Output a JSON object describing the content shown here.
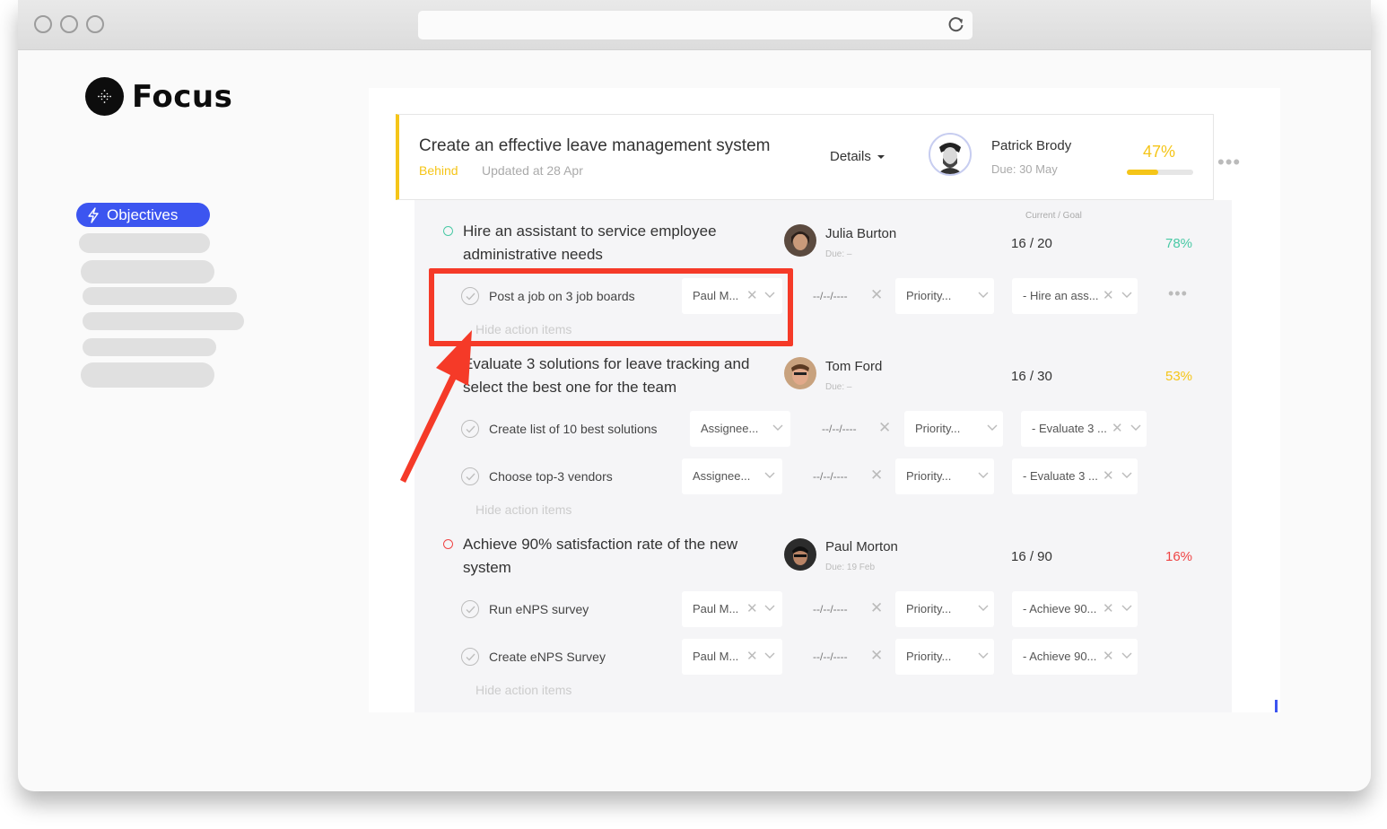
{
  "app": {
    "name": "Focus"
  },
  "sidebar": {
    "active_item": "Objectives"
  },
  "objective": {
    "title": "Create an effective leave management system",
    "status": "Behind",
    "updated": "Updated at 28 Apr",
    "details_label": "Details",
    "owner": "Patrick Brody",
    "due": "Due: 30 May",
    "percent": "47%",
    "progress": 0.47,
    "colors": {
      "behind": "#f5c518",
      "accent": "#3c55f0",
      "highlight": "#f53a28"
    }
  },
  "current_goal_label": "Current / Goal",
  "key_results": [
    {
      "title": "Hire an assistant to service employee administrative needs",
      "owner": "Julia Burton",
      "due": "Due: –",
      "current_goal": "16 / 20",
      "percent": "78%",
      "percent_color": "#49c9a5",
      "status_color": "#49c9a5",
      "action_items": [
        {
          "title": "Post a job on 3 job boards",
          "assignee": "Paul M...",
          "date": "--/--/----",
          "priority": "Priority...",
          "kr": "- Hire an ass..."
        }
      ],
      "hide_label": "Hide action items"
    },
    {
      "title": "Evaluate 3 solutions for leave tracking and select the best one for the team",
      "owner": "Tom Ford",
      "due": "Due: –",
      "current_goal": "16 / 30",
      "percent": "53%",
      "percent_color": "#f5c518",
      "status_color": "#f5c518",
      "action_items": [
        {
          "title": "Create list of 10 best solutions",
          "assignee": "Assignee...",
          "date": "--/--/----",
          "priority": "Priority...",
          "kr": "- Evaluate 3 ..."
        },
        {
          "title": "Choose top-3 vendors",
          "assignee": "Assignee...",
          "date": "--/--/----",
          "priority": "Priority...",
          "kr": "- Evaluate 3 ..."
        }
      ],
      "hide_label": "Hide action items"
    },
    {
      "title": "Achieve 90% satisfaction rate of the new system",
      "owner": "Paul Morton",
      "due": "Due: 19 Feb",
      "current_goal": "16 / 90",
      "percent": "16%",
      "percent_color": "#ef4444",
      "status_color": "#ef4444",
      "action_items": [
        {
          "title": "Run eNPS survey",
          "assignee": "Paul M...",
          "date": "--/--/----",
          "priority": "Priority...",
          "kr": "- Achieve 90..."
        },
        {
          "title": "Create eNPS Survey",
          "assignee": "Paul M...",
          "date": "--/--/----",
          "priority": "Priority...",
          "kr": "- Achieve 90..."
        }
      ],
      "hide_label": "Hide action items"
    }
  ],
  "icons": {
    "reload": "reload-icon",
    "objectives": "lightning-icon",
    "check": "check-circle-icon",
    "clear": "close-icon",
    "dropdown": "chevron-down-icon",
    "more": "more-dots-icon"
  }
}
